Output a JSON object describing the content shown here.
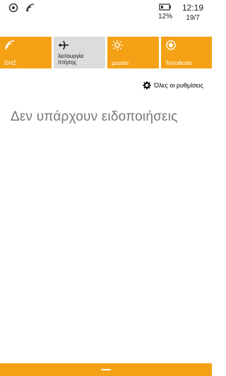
{
  "status_bar": {
    "icons_left": [
      "notification-icon",
      "wifi-icon"
    ],
    "battery_percent": "12%",
    "time": "12:19",
    "date": "19/7"
  },
  "quick_actions": [
    {
      "label": "GHZ",
      "icon": "wifi-icon",
      "state": "on"
    },
    {
      "label": "λειτουργία πτήσης",
      "icon": "airplane-icon",
      "state": "off"
    },
    {
      "label": "μεσαία",
      "icon": "brightness-icon",
      "state": "on"
    },
    {
      "label": "Τοποθεσία",
      "icon": "location-icon",
      "state": "on"
    }
  ],
  "all_settings_label": "Όλες οι ρυθμίσεις",
  "empty_message": "Δεν υπάρχουν ειδοποιήσεις",
  "colors": {
    "accent": "#f4a116",
    "inactive_tile": "#dcdcdc",
    "muted_text": "#777777"
  }
}
